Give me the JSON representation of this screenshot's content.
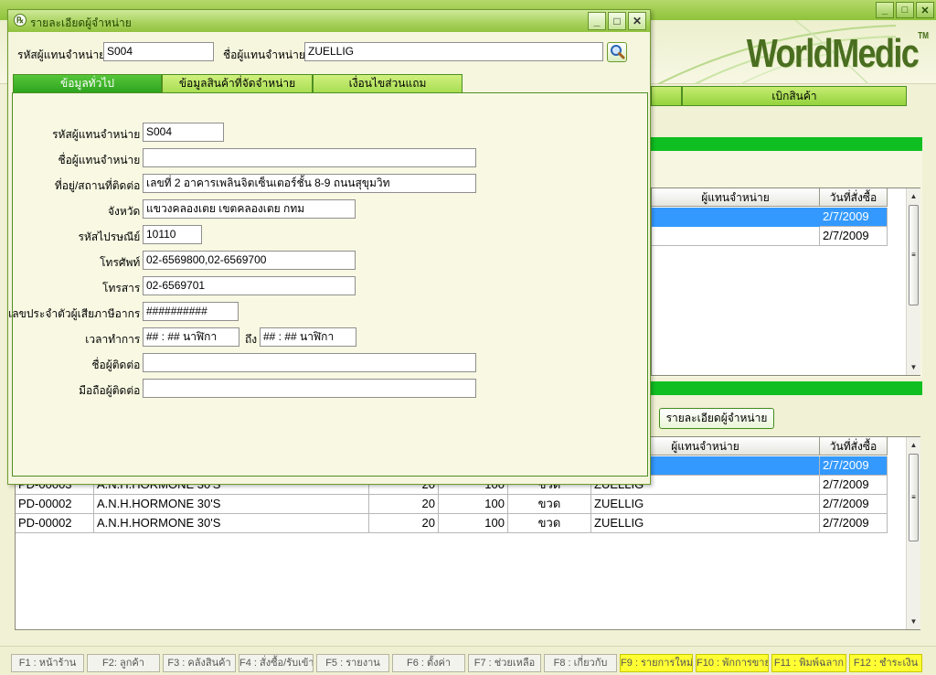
{
  "background": {
    "logo": "WorldMedic",
    "logo_tm": "TM",
    "tabs": [
      "เบิกสินค้า"
    ],
    "upper_grid": {
      "headers": [
        "ผู้แทนจำหน่าย",
        "วันที่สั่งซื้อ"
      ],
      "rows": [
        {
          "date": "2/7/2009",
          "selected": true
        },
        {
          "date": "2/7/2009",
          "selected": false
        }
      ]
    },
    "vendor_detail_button": "รายละเอียดผู้จำหน่าย",
    "lower_grid": {
      "headers": [
        "ผู้แทนจำหน่าย",
        "วันที่สั่งซื้อ"
      ],
      "rows": [
        {
          "code": "",
          "name": "",
          "qty": "",
          "price": "",
          "unit": "",
          "vendor": "",
          "date": "2/7/2009",
          "selected": true
        },
        {
          "code": "PD-00003",
          "name": "A.N.H.HORMONE 30'S",
          "qty": "20",
          "price": "100",
          "unit": "ขวด",
          "vendor": "ZUELLIG",
          "date": "2/7/2009",
          "selected": false
        },
        {
          "code": "PD-00002",
          "name": "A.N.H.HORMONE 30'S",
          "qty": "20",
          "price": "100",
          "unit": "ขวด",
          "vendor": "ZUELLIG",
          "date": "2/7/2009",
          "selected": false
        },
        {
          "code": "PD-00002",
          "name": "A.N.H.HORMONE 30'S",
          "qty": "20",
          "price": "100",
          "unit": "ขวด",
          "vendor": "ZUELLIG",
          "date": "2/7/2009",
          "selected": false
        }
      ]
    },
    "fkeys": [
      {
        "label": "F1 : หน้าร้าน",
        "highlight": false
      },
      {
        "label": "F2: ลูกค้า",
        "highlight": false
      },
      {
        "label": "F3 : คลังสินค้า",
        "highlight": false
      },
      {
        "label": "F4 : สั่งซื้อ/รับเข้า",
        "highlight": false
      },
      {
        "label": "F5 : รายงาน",
        "highlight": false
      },
      {
        "label": "F6 : ตั้งค่า",
        "highlight": false
      },
      {
        "label": "F7 : ช่วยเหลือ",
        "highlight": false
      },
      {
        "label": "F8 : เกี่ยวกับ",
        "highlight": false
      },
      {
        "label": "F9 : รายการใหม่",
        "highlight": true
      },
      {
        "label": "F10 : พักการขาย",
        "highlight": true
      },
      {
        "label": "F11 : พิมพ์ฉลาก",
        "highlight": true
      },
      {
        "label": "F12 : ชำระเงิน",
        "highlight": true
      }
    ]
  },
  "dialog": {
    "title": "รายละเอียดผู้จำหน่าย",
    "header": {
      "code_label": "รหัสผู้แทนจำหน่าย :",
      "code_value": "S004",
      "name_label": "ชื่อผู้แทนจำหน่าย :",
      "name_value": "ZUELLIG"
    },
    "tabs": [
      {
        "label": "ข้อมูลทั่วไป",
        "active": true
      },
      {
        "label": "ข้อมูลสินค้าที่จัดจำหน่าย",
        "active": false
      },
      {
        "label": "เงื่อนไขส่วนแถม",
        "active": false
      }
    ],
    "form": {
      "code_label": "รหัสผู้แทนจำหน่าย :",
      "code_value": "S004",
      "name_label": "ชื่อผู้แทนจำหน่าย :",
      "name_value": "",
      "address_label": "ที่อยู่/สถานที่ติดต่อ :",
      "address_value": "เลขที่ 2 อาคารเพลินจิตเซ็นเตอร์ชั้น 8-9 ถนนสุขุมวิท",
      "province_label": "จังหวัด :",
      "province_value": "แขวงคลองเตย เขตคลองเตย กทม",
      "postcode_label": "รหัสไปรษณีย์ :",
      "postcode_value": "10110",
      "phone_label": "โทรศัพท์ :",
      "phone_value": "02-6569800,02-6569700",
      "fax_label": "โทรสาร :",
      "fax_value": "02-6569701",
      "taxid_label": "เลขประจำตัวผู้เสียภาษีอากร :",
      "taxid_value": "##########",
      "hours_label": "เวลาทำการ :",
      "hours_from": "## : ## นาฬิกา",
      "hours_to_label": "ถึง",
      "hours_to": "## : ## นาฬิกา",
      "contact_label": "ชื่อผู้ติดต่อ :",
      "contact_value": "",
      "mobile_label": "มือถือผู้ติดต่อ :",
      "mobile_value": ""
    }
  }
}
